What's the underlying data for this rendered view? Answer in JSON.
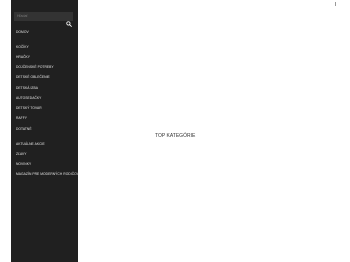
{
  "sidebar": {
    "close_symbol": "×",
    "search": {
      "placeholder": "Hľadať"
    },
    "items": [
      {
        "label": "DOMOV"
      },
      {
        "label": "KOČÍKY"
      },
      {
        "label": "HRAČKY"
      },
      {
        "label": "DOJČENSKÉ POTREBY"
      },
      {
        "label": "DETSKÉ OBLEČENIE"
      },
      {
        "label": "DETSKÁ IZBA"
      },
      {
        "label": "AUTOSEDAČKY"
      },
      {
        "label": "DETSKÝ TOVAR"
      },
      {
        "label": "RAFFY"
      },
      {
        "label": "DOTATNÉ"
      },
      {
        "label": "AKTUÁLNE AKCIE"
      },
      {
        "label": "ZĽAVY"
      },
      {
        "label": "NOVINKY"
      },
      {
        "label": "MAGAZÍN PRE MODERNÝCH RODIČOV"
      }
    ]
  },
  "main": {
    "heading": "TOP KATEGÓRIE"
  },
  "icons": {
    "close": "close-icon",
    "search": "search-icon"
  }
}
